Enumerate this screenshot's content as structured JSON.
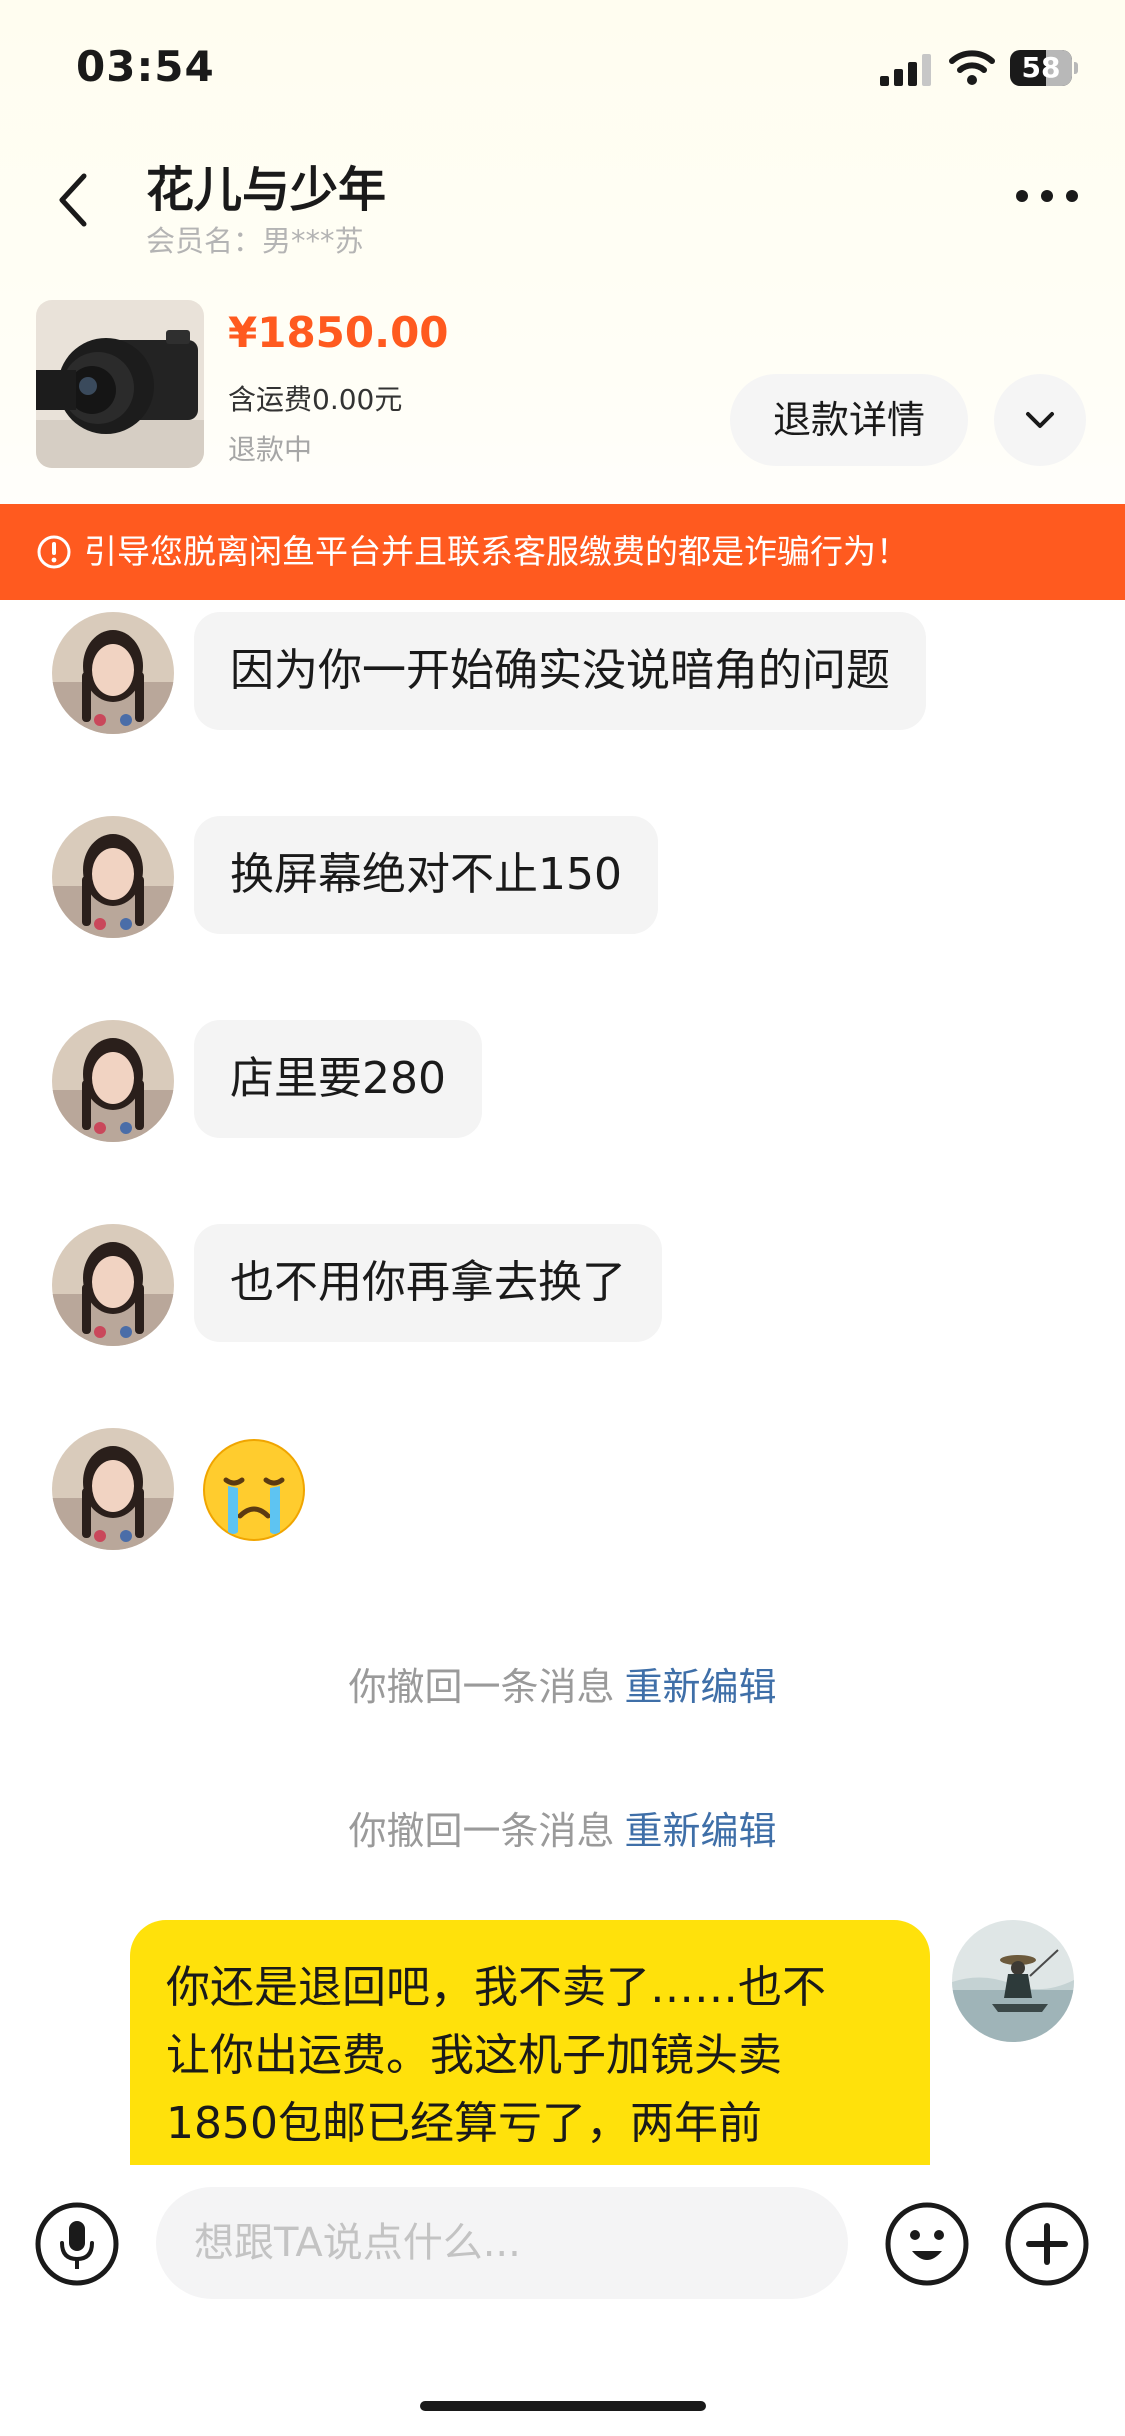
{
  "status_bar": {
    "time": "03:54",
    "battery_level": "58",
    "battery_fraction": 0.58
  },
  "header": {
    "title": "花儿与少年",
    "subtitle": "会员名：男***苏"
  },
  "product": {
    "price": "¥1850.00",
    "shipping": "含运费0.00元",
    "status": "退款中",
    "refund_button": "退款详情"
  },
  "warning": {
    "text": "引导您脱离闲鱼平台并且联系客服缴费的都是诈骗行为！"
  },
  "messages": [
    {
      "text": "因为你一开始确实没说暗角的问题"
    },
    {
      "text": "换屏幕绝对不止150"
    },
    {
      "text": "店里要280"
    },
    {
      "text": "也不用你再拿去换了"
    },
    {
      "emoji": "crying-face-emoji"
    }
  ],
  "recalled": [
    {
      "text": "你撤回一条消息",
      "action": "重新编辑"
    },
    {
      "text": "你撤回一条消息",
      "action": "重新编辑"
    }
  ],
  "outgoing": {
    "lines": [
      "你还是退回吧，我不卖了……也不",
      "让你出运费。我这机子加镜头卖",
      "1850包邮已经算亏了，两年前"
    ]
  },
  "input": {
    "placeholder": "想跟TA说点什么..."
  },
  "colors": {
    "accent": "#ff5a1f",
    "outgoing_bubble": "#ffe10b",
    "link": "#3f6fa8"
  }
}
